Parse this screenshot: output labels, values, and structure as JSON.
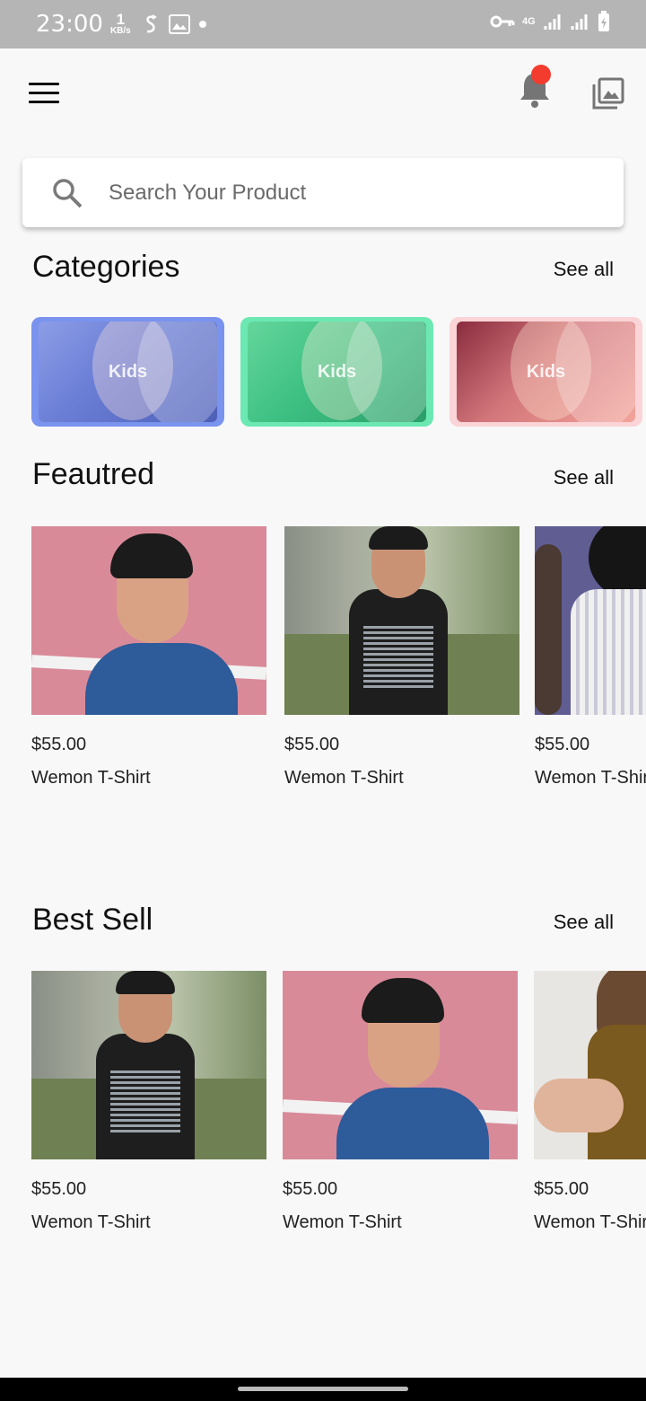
{
  "status_bar": {
    "time": "23:00",
    "speed_value": "1",
    "speed_unit": "KB/s",
    "network": "4G"
  },
  "search": {
    "placeholder": "Search Your Product"
  },
  "categories": {
    "title": "Categories",
    "see_all": "See all",
    "items": [
      {
        "label": "Kids",
        "color": "#7086e0"
      },
      {
        "label": "Kids",
        "color": "#59dfa5"
      },
      {
        "label": "Kids",
        "color": "#f28a8a"
      }
    ]
  },
  "featured": {
    "title": "Feautred",
    "see_all": "See all",
    "items": [
      {
        "price": "$55.00",
        "name": "Wemon T-Shirt"
      },
      {
        "price": "$55.00",
        "name": "Wemon T-Shirt"
      },
      {
        "price": "$55.00",
        "name": "Wemon T-Shirt"
      }
    ]
  },
  "best_sell": {
    "title": "Best Sell",
    "see_all": "See all",
    "items": [
      {
        "price": "$55.00",
        "name": "Wemon T-Shirt"
      },
      {
        "price": "$55.00",
        "name": "Wemon T-Shirt"
      },
      {
        "price": "$55.00",
        "name": "Wemon T-Shirt"
      }
    ]
  },
  "colors": {
    "badge": "#f33c2e",
    "status_bar": "#b5b5b5",
    "background": "#f8f8f8"
  },
  "icons": [
    "menu-icon",
    "bell-icon",
    "gallery-icon",
    "search-icon"
  ]
}
